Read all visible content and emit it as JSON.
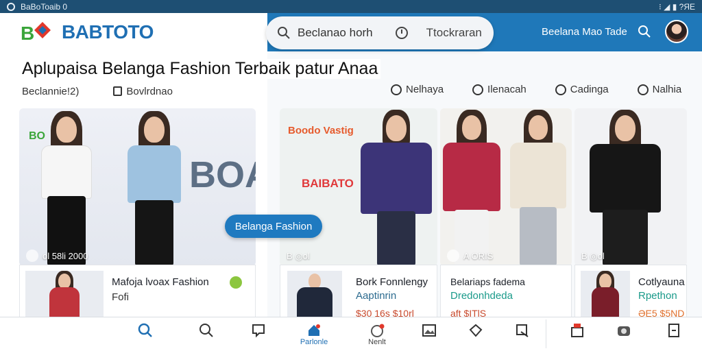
{
  "status_bar": {
    "left_text": "BaBoToaib 0",
    "right_text": "⁝ ◢ ▮ ?ЯE"
  },
  "header": {
    "logo_text": "BABTOTO",
    "search_text": "Beclanao horh",
    "search_placeholder": "Ttockraran",
    "bar_text": "Beelana Mao Tade",
    "accent_color": "#1f78b9"
  },
  "headline": "Aplupaisa Belanga Fashion Terbaik patur Anaa",
  "subnav_left": [
    {
      "label": "Beclannie!2)"
    },
    {
      "label": "Bovlrdnao"
    }
  ],
  "subnav_right": [
    {
      "label": "Nelhaya",
      "icon": "clock-icon"
    },
    {
      "label": "Ilenacah",
      "icon": "user-icon"
    },
    {
      "label": "Cadinga",
      "icon": "profile-icon"
    },
    {
      "label": "Nalhia",
      "icon": "person-icon"
    }
  ],
  "hero_cards": [
    {
      "watermark": "BOA",
      "brand": "BO",
      "foot": "ol   58li 2000"
    },
    {
      "watermark": "BAIBATO",
      "brand": "Boodo Vastig",
      "foot": "B ◎ol"
    },
    {
      "foot": "A ORIS"
    },
    {
      "foot": "B ◎ol"
    }
  ],
  "overlay_button": "Belanga Fashion",
  "products": [
    {
      "title": "Mafoja lvoax Fashion",
      "sub": "Fofi"
    },
    {
      "title": "Bork Fonnlengy",
      "sub": "Aaptinrin",
      "price": "$30 16s $10rl"
    },
    {
      "title": "Belariaps fadema",
      "sub": "Dredonhdeda",
      "price": "aft $ITlS"
    },
    {
      "title": "Cotlyauna",
      "sub": "Rpethon",
      "price": "ƏE5 $5ND"
    }
  ],
  "bottom_nav": [
    {
      "icon": "search-icon",
      "label": ""
    },
    {
      "icon": "search-icon",
      "label": ""
    },
    {
      "icon": "message-icon",
      "label": ""
    },
    {
      "icon": "home-icon",
      "label": "Parlonle"
    },
    {
      "icon": "cart-icon",
      "label": "Nenlt"
    },
    {
      "icon": "gallery-icon",
      "label": ""
    },
    {
      "icon": "share-icon",
      "label": ""
    },
    {
      "icon": "edit-icon",
      "label": ""
    },
    {
      "icon": "bag-icon",
      "label": ""
    },
    {
      "icon": "camera-icon",
      "label": ""
    },
    {
      "icon": "exit-icon",
      "label": ""
    }
  ]
}
